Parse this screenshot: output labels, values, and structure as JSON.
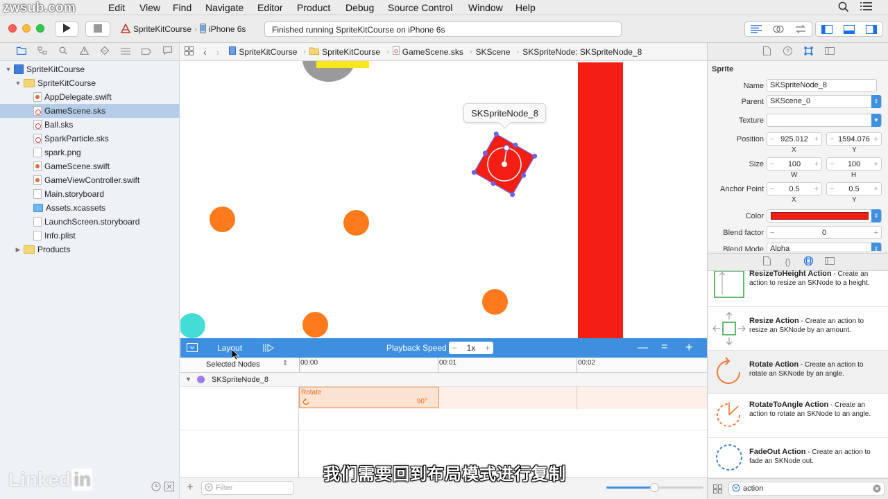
{
  "watermark": "zwsub.com",
  "menubar": {
    "items": [
      "Edit",
      "View",
      "Find",
      "Navigate",
      "Editor",
      "Product",
      "Debug",
      "Source Control",
      "Window",
      "Help"
    ]
  },
  "toolbar": {
    "scheme_target": "SpriteKitCourse",
    "scheme_device": "iPhone 6s",
    "status_text": "Finished running SpriteKitCourse on iPhone 6s"
  },
  "navigator": {
    "items": [
      {
        "label": "SpriteKitCourse",
        "icon": "project-icon",
        "depth": 0,
        "disclosure": "open"
      },
      {
        "label": "SpriteKitCourse",
        "icon": "folder-icon",
        "depth": 1,
        "disclosure": "open"
      },
      {
        "label": "AppDelegate.swift",
        "icon": "swift-file-icon",
        "depth": 2
      },
      {
        "label": "GameScene.sks",
        "icon": "sks-file-icon",
        "depth": 2,
        "selected": true
      },
      {
        "label": "Ball.sks",
        "icon": "sks-file-icon",
        "depth": 2
      },
      {
        "label": "SparkParticle.sks",
        "icon": "sks-file-icon",
        "depth": 2
      },
      {
        "label": "spark.png",
        "icon": "image-file-icon",
        "depth": 2
      },
      {
        "label": "GameScene.swift",
        "icon": "swift-file-icon",
        "depth": 2
      },
      {
        "label": "GameViewController.swift",
        "icon": "swift-file-icon",
        "depth": 2
      },
      {
        "label": "Main.storyboard",
        "icon": "storyboard-file-icon",
        "depth": 2
      },
      {
        "label": "Assets.xcassets",
        "icon": "assets-icon",
        "depth": 2
      },
      {
        "label": "LaunchScreen.storyboard",
        "icon": "storyboard-file-icon",
        "depth": 2
      },
      {
        "label": "Info.plist",
        "icon": "plist-file-icon",
        "depth": 2
      },
      {
        "label": "Products",
        "icon": "folder-icon",
        "depth": 1,
        "disclosure": "closed"
      }
    ]
  },
  "linkedin_logo": {
    "word": "Linked",
    "box": "in"
  },
  "jumpbar": {
    "crumbs": [
      "SpriteKitCourse",
      "SpriteKitCourse",
      "GameScene.sks",
      "SKScene",
      "SKSpriteNode: SKSpriteNode_8"
    ]
  },
  "scene": {
    "tooltip": "SKSpriteNode_8",
    "colors": {
      "orange": "#ff7a1c",
      "cyan": "#44dcd6",
      "red": "#f31f14",
      "gray": "#9a9a9a",
      "yellow": "#f8e71c"
    }
  },
  "timeline": {
    "mode_label": "Layout",
    "playback_label": "Playback Speed",
    "speed_minus": "−",
    "speed_value": "1x",
    "speed_plus": "+",
    "zoom_out": "—",
    "zoom_reset": "=",
    "zoom_in": "+",
    "selected_nodes_label": "Selected Nodes",
    "ticks": [
      "00:00",
      "00:01",
      "00:02"
    ],
    "node_name": "SKSpriteNode_8",
    "action_name": "Rotate",
    "action_value": "90°",
    "filter_placeholder": "Filter"
  },
  "inspector": {
    "section_title": "Sprite",
    "name_label": "Name",
    "name_value": "SKSpriteNode_8",
    "parent_label": "Parent",
    "parent_value": "SKScene_0",
    "texture_label": "Texture",
    "texture_value": "",
    "position_label": "Position",
    "position_x": "925.012",
    "position_y": "1594.076",
    "size_label": "Size",
    "size_w": "100",
    "size_h": "100",
    "anchor_label": "Anchor Point",
    "anchor_x": "0.5",
    "anchor_y": "0.5",
    "color_label": "Color",
    "color_value": "#f31f14",
    "blend_factor_label": "Blend factor",
    "blend_factor_value": "0",
    "blend_mode_label": "Blend Mode",
    "blend_mode_value": "Alpha",
    "x_label": "X",
    "y_label": "Y",
    "w_label": "W",
    "h_label": "H",
    "minus": "−",
    "plus": "+"
  },
  "library": {
    "items": [
      {
        "title": "ResizeToHeight Action",
        "desc": " - Create an action to resize an SKNode to a height."
      },
      {
        "title": "Resize Action",
        "desc": " - Create an action to resize an SKNode by an amount."
      },
      {
        "title": "Rotate Action",
        "desc": " - Create an action to rotate an SKNode by an angle."
      },
      {
        "title": "RotateToAngle Action",
        "desc": " - Create an action to rotate an SKNode to an angle."
      },
      {
        "title": "FadeOut Action",
        "desc": " - Create an action to fade an SKNode out."
      }
    ],
    "search_value": "action"
  },
  "subtitle": "我们需要回到布局模式进行复制"
}
